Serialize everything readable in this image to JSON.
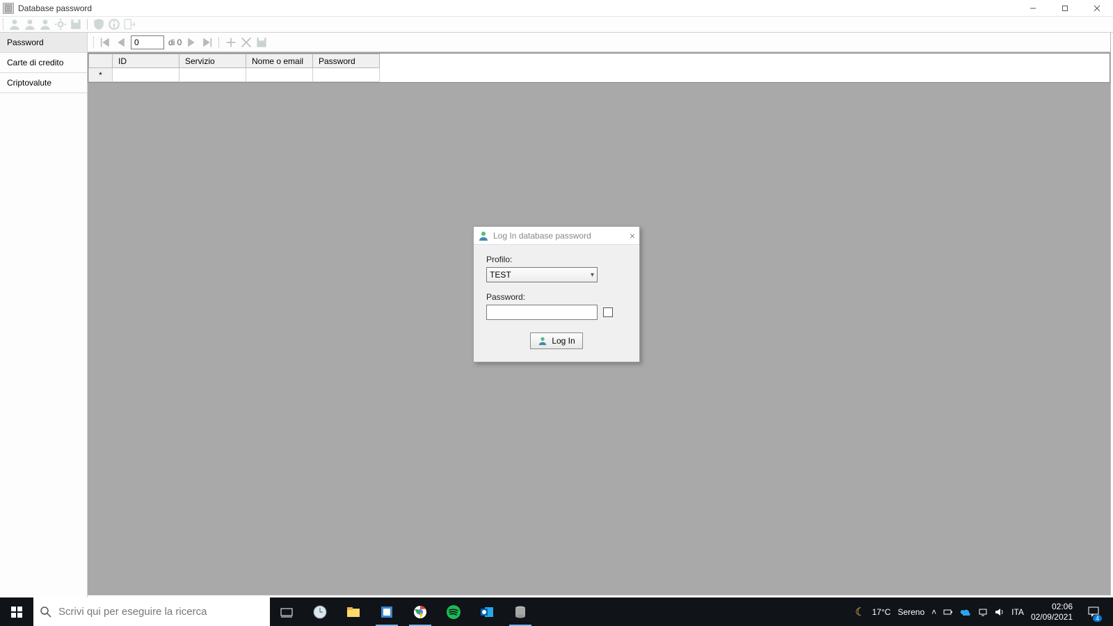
{
  "window": {
    "title": "Database password"
  },
  "sidebar": {
    "items": [
      {
        "label": "Password",
        "active": true
      },
      {
        "label": "Carte di credito",
        "active": false
      },
      {
        "label": "Criptovalute",
        "active": false
      }
    ]
  },
  "navigator": {
    "pos_value": "0",
    "of_text": "di 0"
  },
  "grid": {
    "columns": [
      "ID",
      "Servizio",
      "Nome o email",
      "Password"
    ],
    "new_row_marker": "*"
  },
  "modal": {
    "title": "Log In database password",
    "profile_label": "Profilo:",
    "profile_value": "TEST",
    "password_label": "Password:",
    "password_value": "",
    "login_label": "Log In"
  },
  "taskbar": {
    "search_placeholder": "Scrivi qui per eseguire la ricerca",
    "weather_temp": "17°C",
    "weather_desc": "Sereno",
    "lang": "ITA",
    "time": "02:06",
    "date": "02/09/2021",
    "notif_count": "4"
  }
}
